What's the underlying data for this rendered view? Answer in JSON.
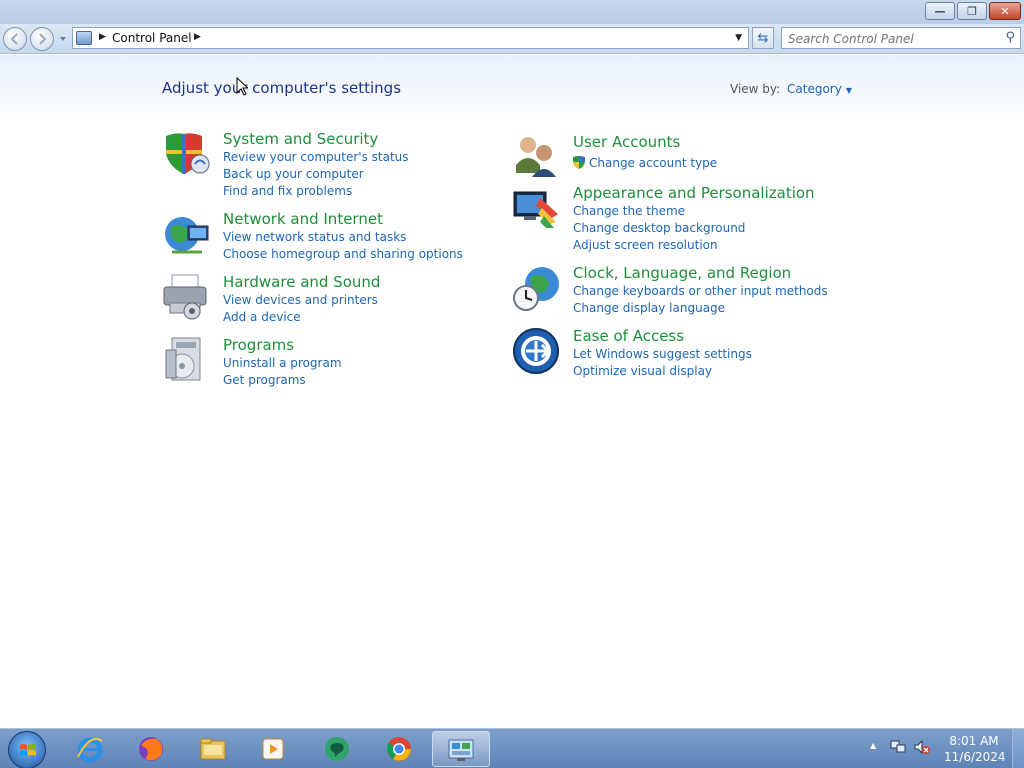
{
  "window": {
    "minimize_glyph": "—",
    "restore_glyph": "❐",
    "close_glyph": "✕"
  },
  "navbar": {
    "breadcrumb": "Control Panel",
    "search_placeholder": "Search Control Panel",
    "back_icon": "back-arrow-icon",
    "forward_icon": "forward-arrow-icon",
    "refresh_icon": "refresh-icon",
    "search_icon": "magnifier-icon"
  },
  "main": {
    "title": "Adjust your computer's settings",
    "view_by_label": "View by:",
    "view_by_value": "Category"
  },
  "categories": [
    {
      "title": "System and Security",
      "icon": "shield-icon",
      "links": [
        "Review your computer's status",
        "Back up your computer",
        "Find and fix problems"
      ]
    },
    {
      "title": "Network and Internet",
      "icon": "globe-network-icon",
      "links": [
        "View network status and tasks",
        "Choose homegroup and sharing options"
      ]
    },
    {
      "title": "Hardware and Sound",
      "icon": "printer-icon",
      "links": [
        "View devices and printers",
        "Add a device"
      ]
    },
    {
      "title": "Programs",
      "icon": "programs-icon",
      "links": [
        "Uninstall a program",
        "Get programs"
      ]
    },
    {
      "title": "User Accounts",
      "icon": "users-icon",
      "links": [
        "Change account type"
      ]
    },
    {
      "title": "Appearance and Personalization",
      "icon": "monitor-paint-icon",
      "links": [
        "Change the theme",
        "Change desktop background",
        "Adjust screen resolution"
      ]
    },
    {
      "title": "Clock, Language, and Region",
      "icon": "clock-globe-icon",
      "links": [
        "Change keyboards or other input methods",
        "Change display language"
      ]
    },
    {
      "title": "Ease of Access",
      "icon": "ease-of-access-icon",
      "links": [
        "Let Windows suggest settings",
        "Optimize visual display"
      ]
    }
  ],
  "taskbar": {
    "items": [
      "internet-explorer-icon",
      "firefox-icon",
      "file-explorer-icon",
      "media-player-icon",
      "chat-app-icon",
      "chrome-icon",
      "control-panel-icon"
    ],
    "clock_time": "8:01 AM",
    "clock_date": "11/6/2024"
  },
  "colors": {
    "category_title": "#1e8f3a",
    "link": "#1e66b4",
    "page_title": "#1e3287"
  }
}
